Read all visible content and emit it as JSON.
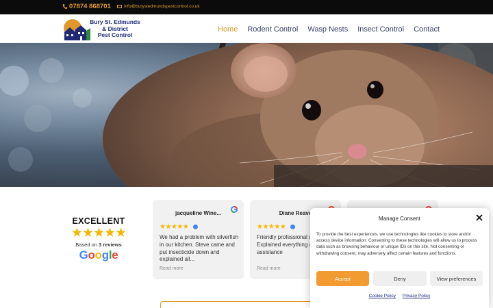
{
  "topbar": {
    "phone": "07874 868701",
    "email": "info@burystedmundspestcontrol.co.uk"
  },
  "logo": {
    "line1": "Bury St. Edmunds",
    "line2": "& District",
    "line3": "Pest Control"
  },
  "nav": {
    "items": [
      {
        "label": "Home",
        "active": true
      },
      {
        "label": "Rodent Control",
        "active": false
      },
      {
        "label": "Wasp Nests",
        "active": false
      },
      {
        "label": "Insect Control",
        "active": false
      },
      {
        "label": "Contact",
        "active": false
      }
    ]
  },
  "reviews_summary": {
    "rating_word": "EXCELLENT",
    "stars": "★★★★★",
    "based_on_prefix": "Based on ",
    "review_count": "3 reviews",
    "brand": "Google"
  },
  "reviews": [
    {
      "name": "jacqueline Wine...",
      "stars": "★★★★★",
      "text": "We had a problem with silverfish in our kitchen. Steve came and put insecticide down and explained all...",
      "more": "Read more"
    },
    {
      "name": "Diane Reave",
      "stars": "★★★★★",
      "text": "Friendly professional service .\nExplained everything aftercare assistance",
      "more": "Read more"
    }
  ],
  "consent": {
    "title": "Manage Consent",
    "body": "To provide the best experiences, we use technologies like cookies to store and/or access device information. Consenting to these technologies will allow us to process data such as browsing behaviour or unique IDs on this site. Not consenting or withdrawing consent, may adversely affect certain features and functions.",
    "accept": "Accept",
    "deny": "Deny",
    "preferences": "View preferences",
    "cookie_policy": "Cookie Policy",
    "privacy_policy": "Privacy Policy"
  },
  "colors": {
    "accent": "#e09a2b",
    "accept_button": "#f29b30",
    "navy": "#1e2a78",
    "star": "#f6b700"
  },
  "icons": [
    "phone-icon",
    "mail-icon",
    "google-g-icon",
    "verified-icon",
    "close-icon"
  ]
}
